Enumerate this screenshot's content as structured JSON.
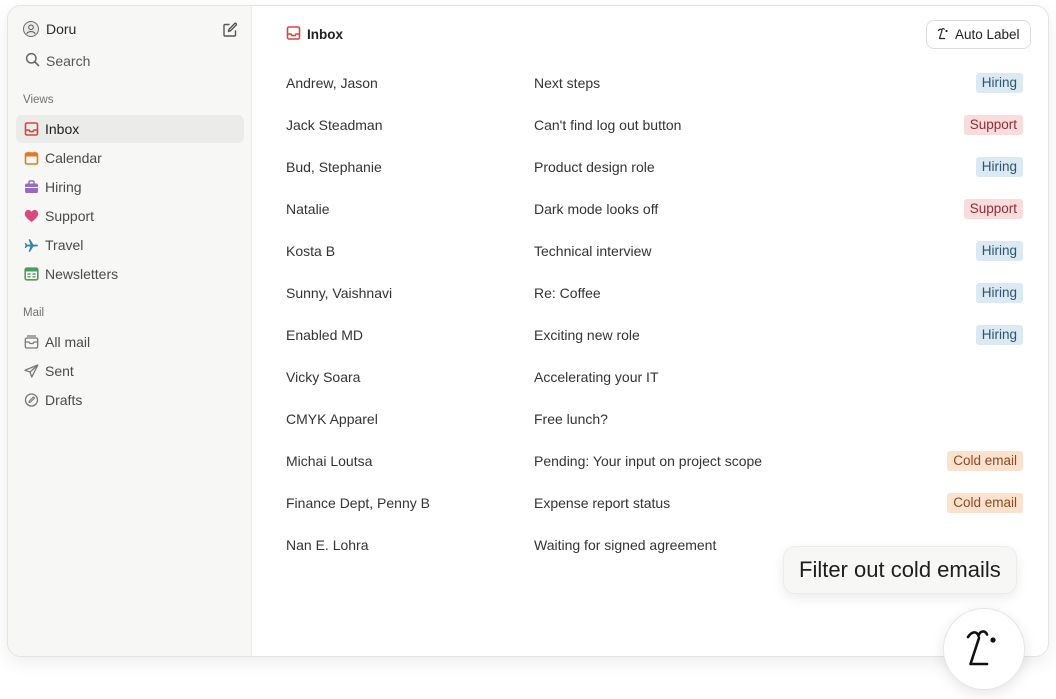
{
  "account": {
    "name": "Doru",
    "avatar_icon": "person-avatar-icon",
    "compose_icon": "compose-icon"
  },
  "search": {
    "label": "Search"
  },
  "sections": {
    "views": "Views",
    "mail": "Mail"
  },
  "views": [
    {
      "label": "Inbox",
      "icon": "inbox-icon",
      "color": "#d64541",
      "active": true
    },
    {
      "label": "Calendar",
      "icon": "calendar-icon",
      "color": "#e07b24"
    },
    {
      "label": "Hiring",
      "icon": "briefcase-icon",
      "color": "#9a6bc4"
    },
    {
      "label": "Support",
      "icon": "heart-icon",
      "color": "#d9487e"
    },
    {
      "label": "Travel",
      "icon": "airplane-icon",
      "color": "#3a7fae"
    },
    {
      "label": "Newsletters",
      "icon": "newspaper-icon",
      "color": "#4f9a5e"
    }
  ],
  "mail": [
    {
      "label": "All mail",
      "icon": "archive-icon"
    },
    {
      "label": "Sent",
      "icon": "send-icon"
    },
    {
      "label": "Drafts",
      "icon": "draft-icon"
    }
  ],
  "main": {
    "title": "Inbox",
    "auto_label_button": "Auto Label",
    "emails": [
      {
        "sender": "Andrew, Jason",
        "subject": "Next steps",
        "label": "Hiring",
        "label_type": "hiring"
      },
      {
        "sender": "Jack Steadman",
        "subject": "Can't find log out button",
        "label": "Support",
        "label_type": "support"
      },
      {
        "sender": "Bud, Stephanie",
        "subject": "Product design role",
        "label": "Hiring",
        "label_type": "hiring"
      },
      {
        "sender": "Natalie",
        "subject": "Dark mode looks off",
        "label": "Support",
        "label_type": "support"
      },
      {
        "sender": "Kosta B",
        "subject": "Technical interview",
        "label": "Hiring",
        "label_type": "hiring"
      },
      {
        "sender": "Sunny, Vaishnavi",
        "subject": "Re: Coffee",
        "label": "Hiring",
        "label_type": "hiring"
      },
      {
        "sender": "Enabled MD",
        "subject": "Exciting new role",
        "label": "Hiring",
        "label_type": "hiring"
      },
      {
        "sender": "Vicky Soara",
        "subject": "Accelerating your IT",
        "label": "",
        "label_type": ""
      },
      {
        "sender": "CMYK Apparel",
        "subject": "Free lunch?",
        "label": "",
        "label_type": ""
      },
      {
        "sender": "Michai Loutsa",
        "subject": "Pending: Your input on project scope",
        "label": "Cold email",
        "label_type": "cold"
      },
      {
        "sender": "Finance Dept, Penny B",
        "subject": "Expense report status",
        "label": "Cold email",
        "label_type": "cold"
      },
      {
        "sender": "Nan E. Lohra",
        "subject": "Waiting for signed agreement",
        "label": "",
        "label_type": ""
      }
    ]
  },
  "assistant": {
    "prompt_bubble": "Filter out cold emails",
    "button_icon": "ai-assistant-icon"
  }
}
